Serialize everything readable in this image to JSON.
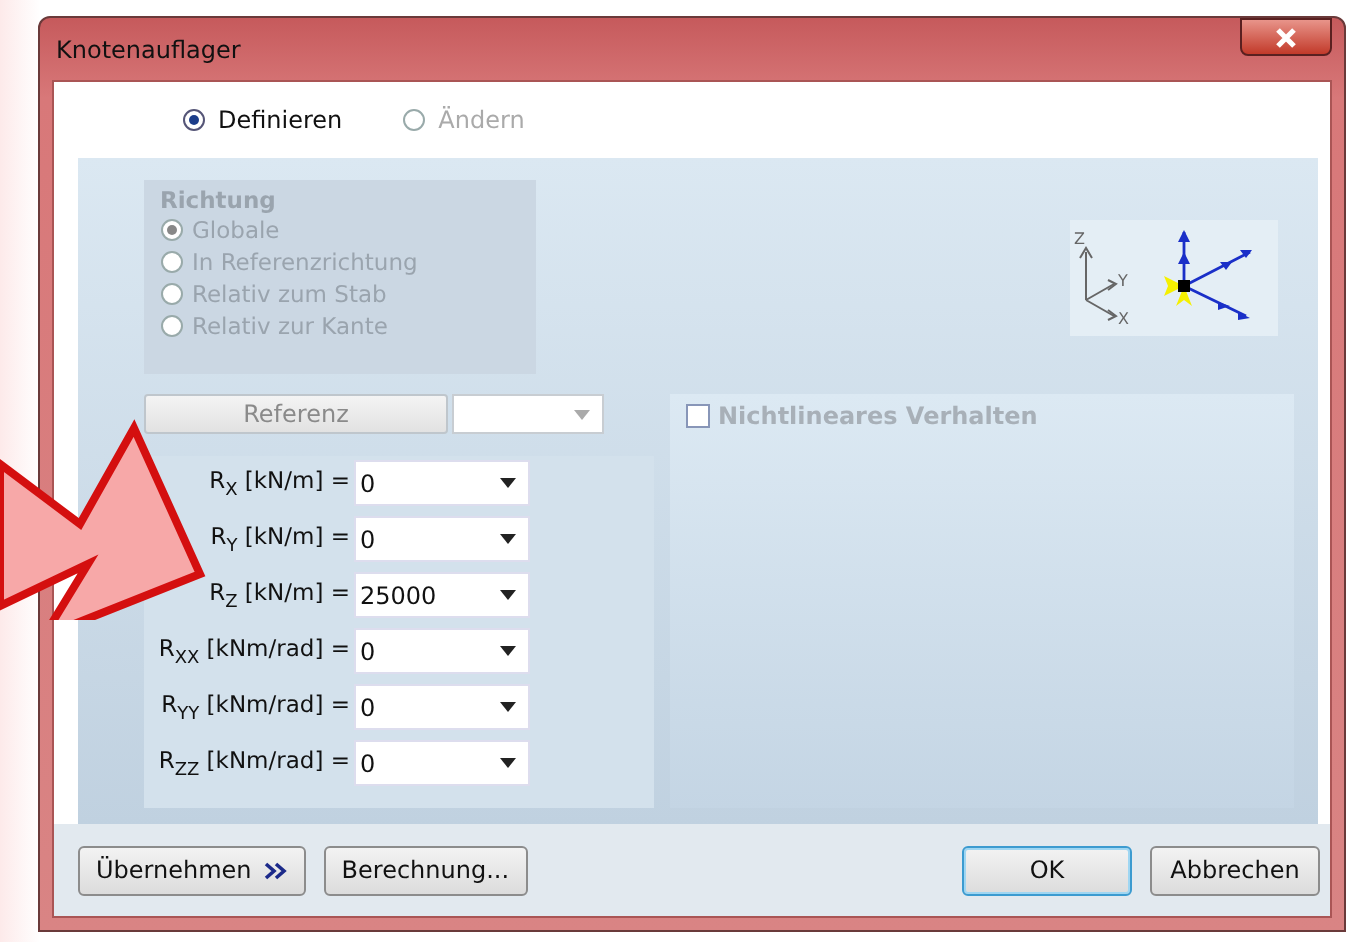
{
  "window": {
    "title": "Knotenauflager"
  },
  "mode_options": [
    {
      "label": "Definieren",
      "selected": true,
      "disabled": false
    },
    {
      "label": "Ändern",
      "selected": false,
      "disabled": true
    }
  ],
  "direction": {
    "title": "Richtung",
    "disabled": true,
    "options": [
      {
        "label": "Globale",
        "selected": true
      },
      {
        "label": "In Referenzrichtung",
        "selected": false
      },
      {
        "label": "Relativ zum Stab",
        "selected": false
      },
      {
        "label": "Relativ zur Kante",
        "selected": false
      }
    ]
  },
  "axis_labels": [
    "Z",
    "Y",
    "X"
  ],
  "reference": {
    "button": "Referenz",
    "disabled": true
  },
  "stiffness": [
    {
      "label": "R$_{X}$ [kN/m] =",
      "value": "0"
    },
    {
      "label": "R$_{Y}$ [kN/m] =",
      "value": "0"
    },
    {
      "label": "R$_{Z}$ [kN/m] =",
      "value": "25000"
    },
    {
      "label": "R$_{XX}$ [kNm/rad] =",
      "value": "0"
    },
    {
      "label": "R$_{YY}$ [kNm/rad] =",
      "value": "0"
    },
    {
      "label": "R$_{ZZ}$ [kNm/rad] =",
      "value": "0"
    }
  ],
  "nonlinear": {
    "label": "Nichtlineares Verhalten",
    "checked": false,
    "disabled": true
  },
  "footer_buttons": [
    {
      "label": "Übernehmen",
      "kind": "apply",
      "default": false
    },
    {
      "label": "Berechnung...",
      "kind": "plain",
      "default": false
    },
    {
      "label": "OK",
      "kind": "plain",
      "default": true
    },
    {
      "label": "Abbrechen",
      "kind": "plain",
      "default": false
    }
  ]
}
